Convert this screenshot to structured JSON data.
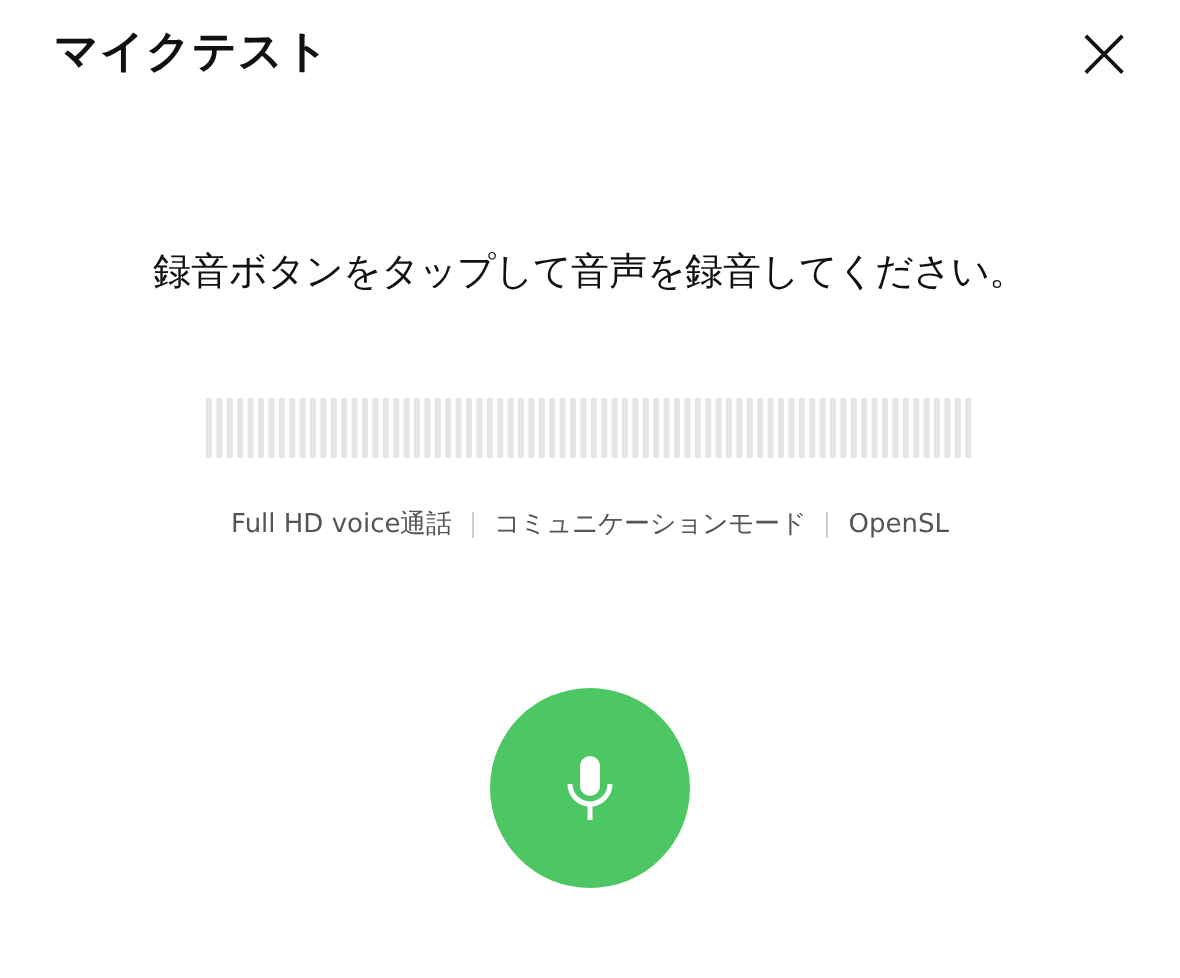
{
  "dialog": {
    "title": "マイクテスト",
    "close": "×"
  },
  "instruction": "録音ボタンをタップして音声を録音してください。",
  "info": [
    "Full HD voice通話",
    "コミュニケーションモード",
    "OpenSL"
  ]
}
